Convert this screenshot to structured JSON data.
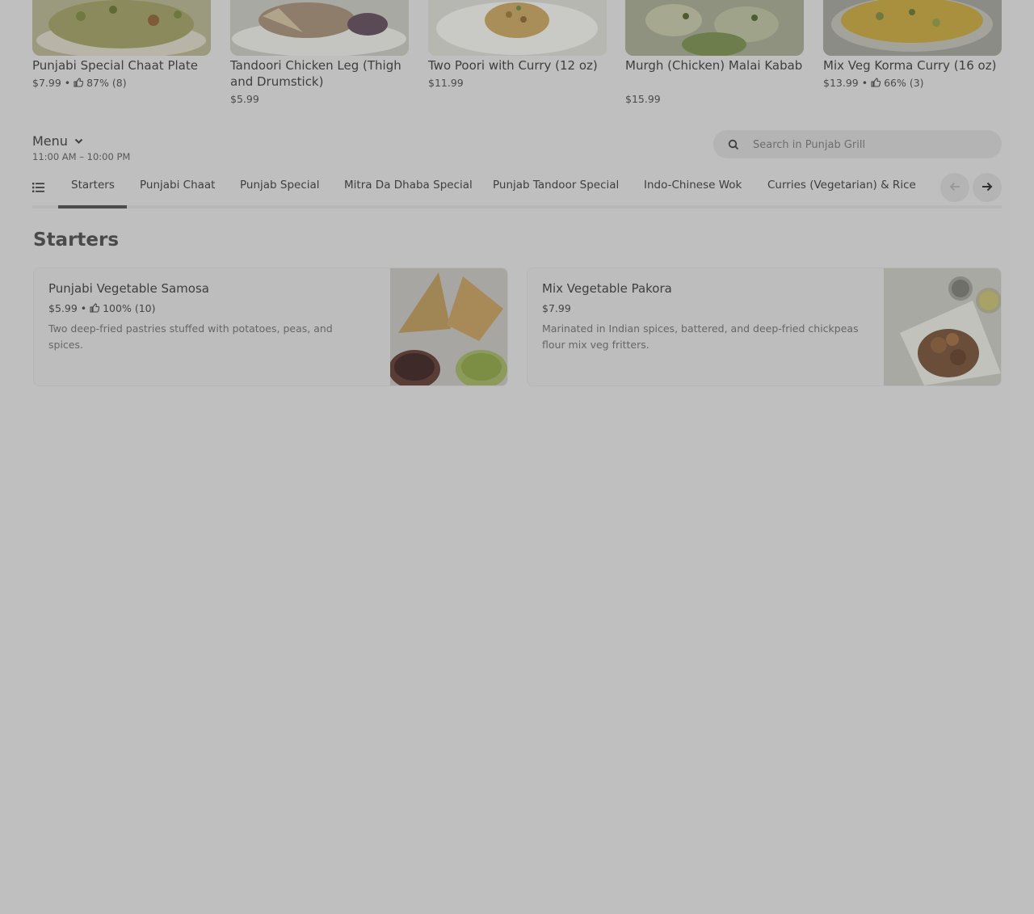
{
  "featured": [
    {
      "name": "Punjabi Special Chaat Plate",
      "price": "$7.99",
      "rating": "87% (8)"
    },
    {
      "name": "Tandoori Chicken Leg (Thigh and Drumstick)",
      "price": "$5.99",
      "rating": ""
    },
    {
      "name": "Two Poori with Curry (12 oz)",
      "price": "$11.99",
      "rating": ""
    },
    {
      "name": "Murgh (Chicken) Malai Kabab",
      "price": "$15.99",
      "rating": ""
    },
    {
      "name": "Mix Veg Korma Curry (16 oz)",
      "price": "$13.99",
      "rating": "66% (3)"
    }
  ],
  "menu": {
    "title": "Menu",
    "hours": "11:00 AM – 10:00 PM"
  },
  "search": {
    "placeholder": "Search in Punjab Grill"
  },
  "tabs": [
    "Starters",
    "Punjabi Chaat",
    "Punjab Special",
    "Mitra Da Dhaba Special",
    "Punjab Tandoor Special",
    "Indo-Chinese Wok",
    "Curries (Vegetarian) & Rice"
  ],
  "active_tab": "Starters",
  "section": {
    "title": "Starters",
    "items": [
      {
        "name": "Punjabi Vegetable Samosa",
        "price": "$5.99",
        "rating": "100% (10)",
        "description": "Two deep-fried pastries stuffed with potatoes, peas, and spices."
      },
      {
        "name": "Mix Vegetable Pakora",
        "price": "$7.99",
        "rating": "",
        "description": "Marinated in Indian spices, battered, and deep-fried chickpeas flour mix veg fritters."
      }
    ]
  },
  "icons": {
    "rating": "thumbs-up-icon",
    "search": "search-icon",
    "menu_dropdown": "chevron-down-icon",
    "category_list": "list-icon",
    "prev": "arrow-left-icon",
    "next": "arrow-right-icon"
  },
  "colors": {
    "overlay_bg": "#bfbfbf",
    "text": "#3e3e3e",
    "active_underline": "#4b4b4b"
  }
}
